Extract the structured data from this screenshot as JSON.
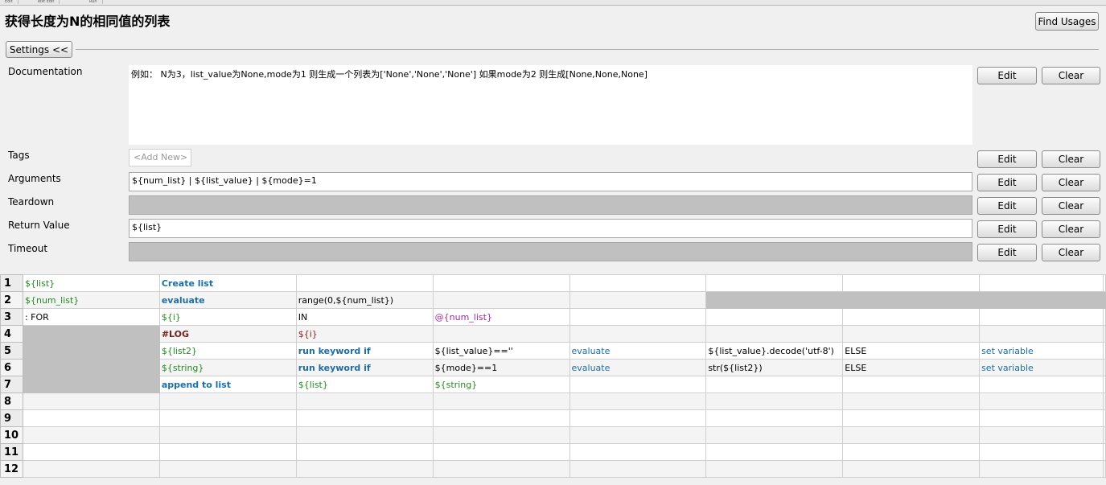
{
  "tab_strip": [
    "Edit",
    "Text Edit",
    "Run"
  ],
  "keyword_title": "获得长度为N的相同值的列表",
  "find_usages_label": "Find Usages",
  "settings_label": "Settings <<",
  "edit_label": "Edit",
  "clear_label": "Clear",
  "settings": {
    "documentation": {
      "label": "Documentation",
      "value": "例如： N为3，list_value为None,mode为1 则生成一个列表为['None','None','None'] 如果mode为2 则生成[None,None,None]"
    },
    "tags": {
      "label": "Tags",
      "placeholder": "<Add New>"
    },
    "arguments": {
      "label": "Arguments",
      "value": "${num_list} | ${list_value} | ${mode}=1"
    },
    "teardown": {
      "label": "Teardown",
      "value": ""
    },
    "return_value": {
      "label": "Return Value",
      "value": "${list}"
    },
    "timeout": {
      "label": "Timeout",
      "value": ""
    }
  },
  "grid_rows": [
    {
      "n": "1",
      "cells": [
        {
          "t": "${list}",
          "s": "var"
        },
        {
          "t": "Create list",
          "s": "kw"
        },
        {
          "t": ""
        },
        {
          "t": ""
        },
        {
          "t": ""
        },
        {
          "t": ""
        },
        {
          "t": ""
        },
        {
          "t": ""
        }
      ]
    },
    {
      "n": "2",
      "cells": [
        {
          "t": "${num_list}",
          "s": "var"
        },
        {
          "t": "evaluate",
          "s": "kw"
        },
        {
          "t": "range(0,${num_list})"
        },
        {
          "t": ""
        },
        {
          "t": ""
        },
        {
          "t": "",
          "s": "gray"
        },
        {
          "t": "",
          "s": "gray"
        },
        {
          "t": "",
          "s": "gray"
        }
      ]
    },
    {
      "n": "3",
      "cells": [
        {
          "t": ": FOR"
        },
        {
          "t": "${i}",
          "s": "var"
        },
        {
          "t": "IN"
        },
        {
          "t": "@{num_list}",
          "s": "lvar"
        },
        {
          "t": ""
        },
        {
          "t": ""
        },
        {
          "t": ""
        },
        {
          "t": ""
        }
      ]
    },
    {
      "n": "4",
      "cells": [
        {
          "t": "",
          "s": "gray"
        },
        {
          "t": "#LOG",
          "s": "cmt"
        },
        {
          "t": "${i}",
          "s": "vs"
        },
        {
          "t": ""
        },
        {
          "t": ""
        },
        {
          "t": ""
        },
        {
          "t": ""
        },
        {
          "t": ""
        }
      ]
    },
    {
      "n": "5",
      "cells": [
        {
          "t": "",
          "s": "gray"
        },
        {
          "t": "${list2}",
          "s": "var"
        },
        {
          "t": "run keyword if",
          "s": "kw"
        },
        {
          "t": "${list_value}==''"
        },
        {
          "t": "evaluate",
          "s": "lib"
        },
        {
          "t": "${list_value}.decode('utf-8')"
        },
        {
          "t": "ELSE"
        },
        {
          "t": "set variable",
          "s": "lib"
        }
      ]
    },
    {
      "n": "6",
      "cells": [
        {
          "t": "",
          "s": "gray"
        },
        {
          "t": "${string}",
          "s": "var"
        },
        {
          "t": "run keyword if",
          "s": "kw"
        },
        {
          "t": "${mode}==1"
        },
        {
          "t": "evaluate",
          "s": "lib"
        },
        {
          "t": "str(${list2})"
        },
        {
          "t": "ELSE"
        },
        {
          "t": "set variable",
          "s": "lib"
        }
      ]
    },
    {
      "n": "7",
      "cells": [
        {
          "t": "",
          "s": "gray"
        },
        {
          "t": "append to list",
          "s": "kw"
        },
        {
          "t": "${list}",
          "s": "var"
        },
        {
          "t": "${string}",
          "s": "var"
        },
        {
          "t": ""
        },
        {
          "t": ""
        },
        {
          "t": ""
        },
        {
          "t": ""
        }
      ]
    },
    {
      "n": "8",
      "cells": [
        {
          "t": ""
        },
        {
          "t": ""
        },
        {
          "t": ""
        },
        {
          "t": ""
        },
        {
          "t": ""
        },
        {
          "t": ""
        },
        {
          "t": ""
        },
        {
          "t": ""
        }
      ]
    },
    {
      "n": "9",
      "cells": [
        {
          "t": ""
        },
        {
          "t": ""
        },
        {
          "t": ""
        },
        {
          "t": ""
        },
        {
          "t": ""
        },
        {
          "t": ""
        },
        {
          "t": ""
        },
        {
          "t": ""
        }
      ]
    },
    {
      "n": "10",
      "cells": [
        {
          "t": ""
        },
        {
          "t": ""
        },
        {
          "t": ""
        },
        {
          "t": ""
        },
        {
          "t": ""
        },
        {
          "t": ""
        },
        {
          "t": ""
        },
        {
          "t": ""
        }
      ]
    },
    {
      "n": "11",
      "cells": [
        {
          "t": ""
        },
        {
          "t": ""
        },
        {
          "t": ""
        },
        {
          "t": ""
        },
        {
          "t": ""
        },
        {
          "t": ""
        },
        {
          "t": ""
        },
        {
          "t": ""
        }
      ]
    },
    {
      "n": "12",
      "cells": [
        {
          "t": ""
        },
        {
          "t": ""
        },
        {
          "t": ""
        },
        {
          "t": ""
        },
        {
          "t": ""
        },
        {
          "t": ""
        },
        {
          "t": ""
        },
        {
          "t": ""
        }
      ]
    }
  ],
  "colors": {
    "variable": "#268a23",
    "keyword": "#1c6ea4",
    "comment": "#7a2020",
    "list_variable": "#a02ca0",
    "disabled_field": "#c0c0c0"
  }
}
